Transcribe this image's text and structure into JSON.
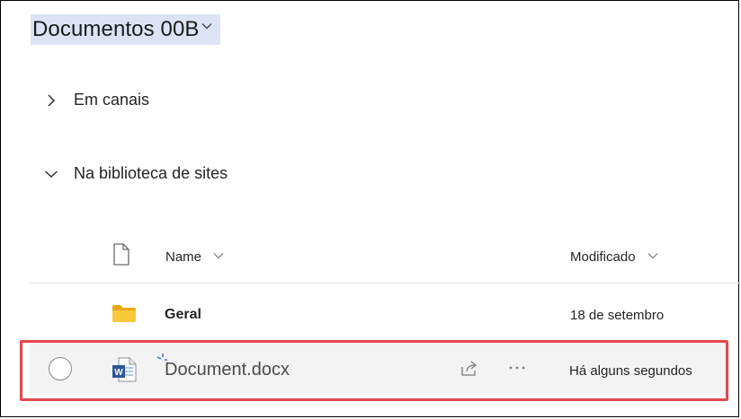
{
  "header": {
    "title": "Documentos 00B"
  },
  "sections": {
    "channels_label": "Em canais",
    "site_library_label": "Na biblioteca de sites"
  },
  "columns": {
    "name": "Name",
    "modified": "Modificado"
  },
  "rows": [
    {
      "name": "Geral",
      "type": "folder",
      "modified": "18 de setembro"
    },
    {
      "name": "Document.docx",
      "type": "word-document",
      "modified": "Há alguns segundos"
    }
  ],
  "colors": {
    "title_highlight": "#dde3f5",
    "selected_row": "#f3f3f3",
    "callout": "#e3474e",
    "folder": "#f2c230",
    "word": "#2b579a"
  }
}
